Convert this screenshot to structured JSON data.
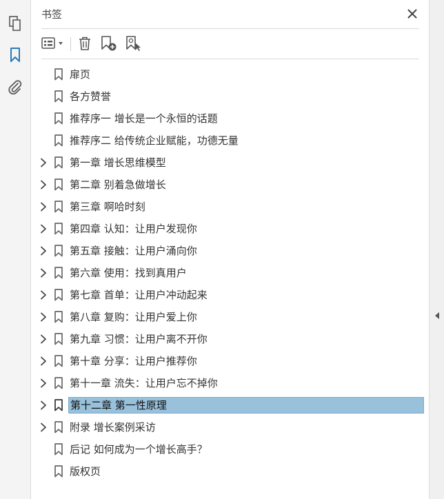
{
  "panel": {
    "title": "书签"
  },
  "colors": {
    "selected_bg": "#99c1dc",
    "active_icon": "#2a7ab8",
    "icon_gray": "#555555"
  },
  "left_rail": {
    "icons": [
      "pages-icon",
      "bookmark-icon",
      "attachment-icon"
    ],
    "active": "bookmark-icon"
  },
  "toolbar": {
    "icons": [
      "options-menu-icon",
      "delete-icon",
      "new-bookmark-icon",
      "bookmark-from-selection-icon"
    ]
  },
  "bookmarks": [
    {
      "label": "扉页",
      "expandable": false
    },
    {
      "label": "各方赞誉",
      "expandable": false
    },
    {
      "label": "推荐序一 增长是一个永恒的话题",
      "expandable": false
    },
    {
      "label": "推荐序二 给传统企业赋能，功德无量",
      "expandable": false
    },
    {
      "label": "第一章 增长思维模型",
      "expandable": true
    },
    {
      "label": "第二章 别着急做增长",
      "expandable": true
    },
    {
      "label": "第三章 啊哈时刻",
      "expandable": true
    },
    {
      "label": "第四章 认知：让用户发现你",
      "expandable": true
    },
    {
      "label": "第五章 接触：让用户涌向你",
      "expandable": true
    },
    {
      "label": "第六章 使用：找到真用户",
      "expandable": true
    },
    {
      "label": "第七章 首单：让用户冲动起来",
      "expandable": true
    },
    {
      "label": "第八章 复购：让用户爱上你",
      "expandable": true
    },
    {
      "label": "第九章 习惯：让用户离不开你",
      "expandable": true
    },
    {
      "label": "第十章 分享：让用户推荐你",
      "expandable": true
    },
    {
      "label": "第十一章 流失：让用户忘不掉你",
      "expandable": true
    },
    {
      "label": "第十二章 第一性原理",
      "expandable": true,
      "selected": true
    },
    {
      "label": "附录 增长案例采访",
      "expandable": true
    },
    {
      "label": "后记 如何成为一个增长高手？",
      "expandable": false
    },
    {
      "label": "版权页",
      "expandable": false
    }
  ]
}
